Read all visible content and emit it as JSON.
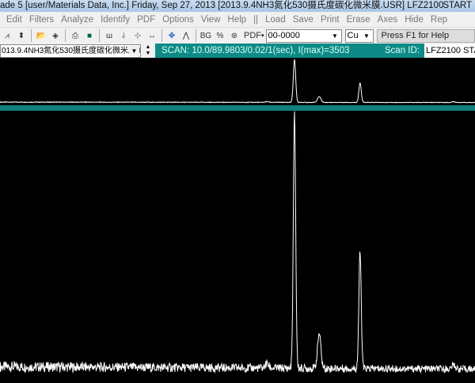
{
  "title": {
    "text": "ade 5 [user/Materials Data, Inc.] Friday, Sep 27, 2013 [2013.9.4NH3氮化530摄氏度碳化微米膜.USR] LFZ2100",
    "start": "START"
  },
  "menu": [
    "Edit",
    "Filters",
    "Analyze",
    "Identify",
    "PDF",
    "Options",
    "View",
    "Help",
    "||",
    "Load",
    "Save",
    "Print",
    "Erase",
    "Axes",
    "Hide",
    "Rep"
  ],
  "toolbar": {
    "icons": [
      "pattern-icon",
      "up-down-icon",
      "open-folder-icon",
      "eraser-icon",
      "print-icon",
      "save-icon",
      "peak-icon",
      "fit-icon",
      "zoom-in-icon",
      "zoom-out-icon",
      "move-icon",
      "peak-search-icon",
      "bg-icon",
      "ratio-icon",
      "globe-icon"
    ],
    "pdf_label": "PDF",
    "pdf_value": "00-0000",
    "element_value": "Cu",
    "help_text": "Press F1 for Help"
  },
  "scan": {
    "file": "013.9.4NH3氮化530摄氏度碳化微米膜.U",
    "info": "SCAN: 10.0/89.9803/0.02/1(sec), I(max)=3503",
    "id_label": "Scan ID:",
    "id_value": "LFZ2100   STA"
  },
  "colors": {
    "accent": "#0e8a86",
    "trace": "#ffffff",
    "background": "#000000"
  },
  "chart_data": {
    "type": "line",
    "imax": 3503,
    "peaks": [
      {
        "rel_pos": 0.562,
        "intensity": 60
      },
      {
        "rel_pos": 0.62,
        "intensity": 3503
      },
      {
        "rel_pos": 0.672,
        "intensity": 480
      },
      {
        "rel_pos": 0.758,
        "intensity": 1600
      },
      {
        "rel_pos": 0.955,
        "intensity": 60
      }
    ],
    "background_intensity": 110
  }
}
